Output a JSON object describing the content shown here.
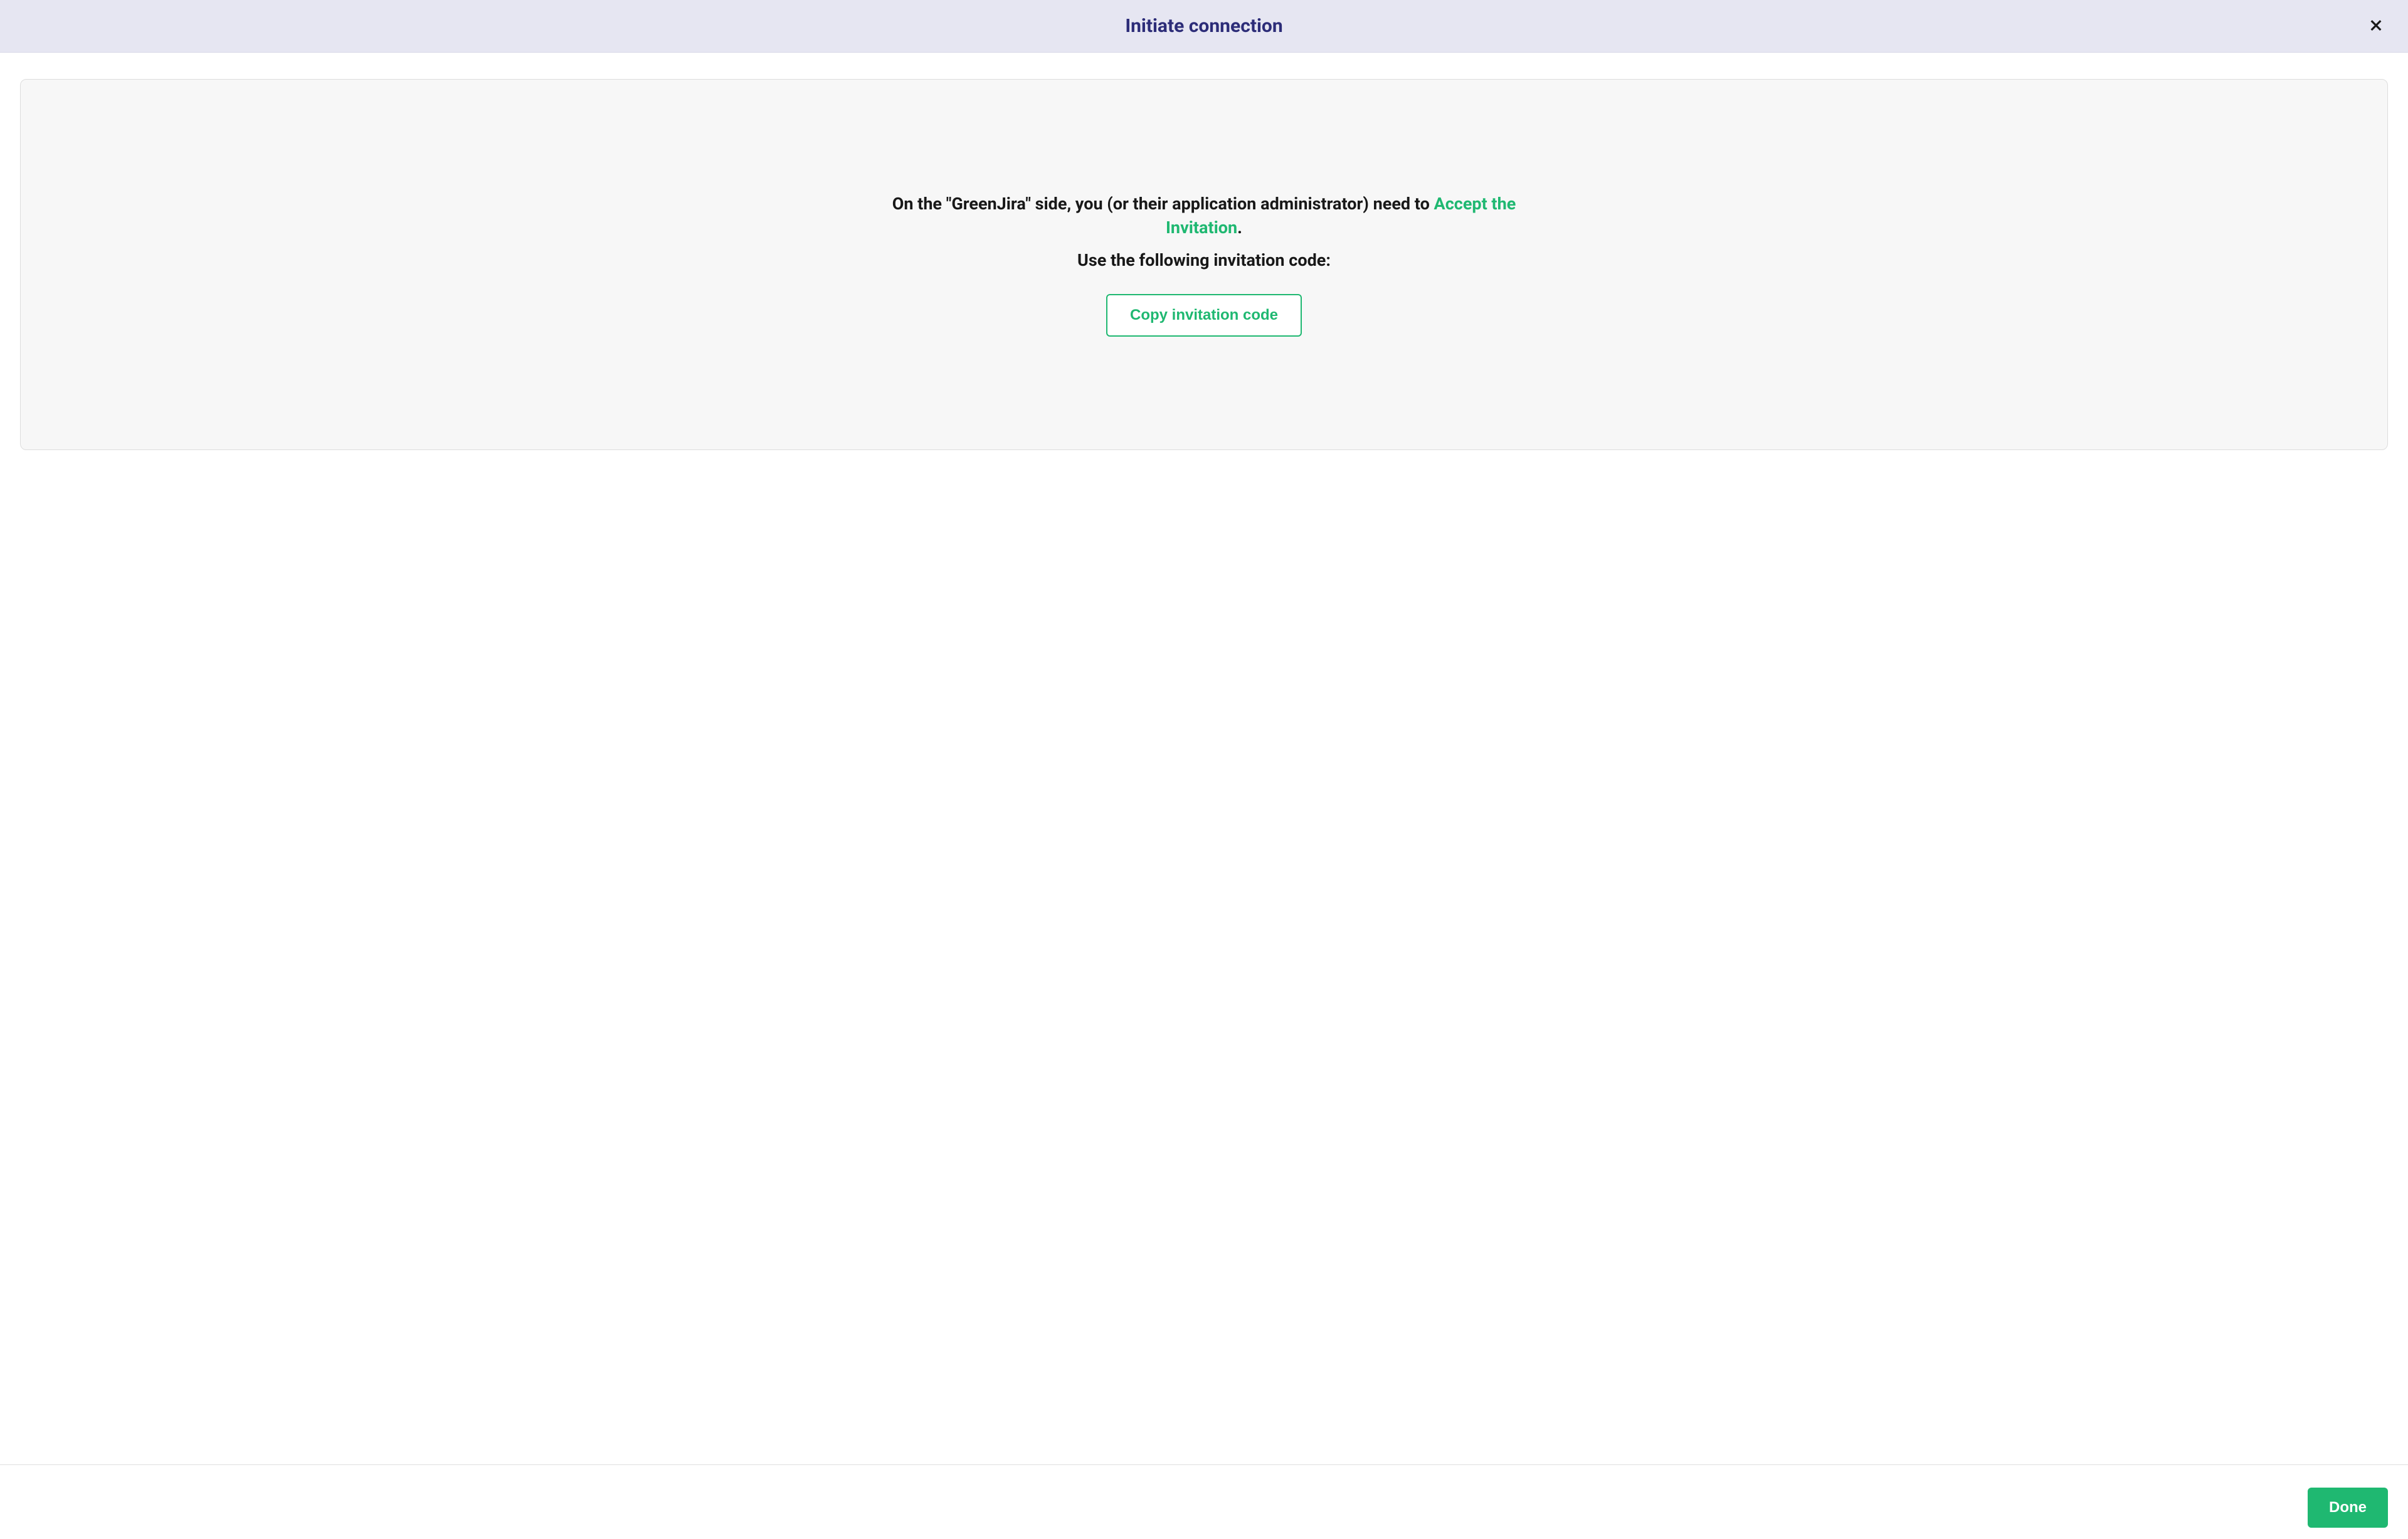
{
  "dialog": {
    "title": "Initiate connection"
  },
  "content": {
    "instruction_prefix": "On the \"GreenJira\" side, you (or their application administrator) need to ",
    "accept_link": "Accept the Invitation",
    "instruction_suffix": ".",
    "sub_instruction": "Use the following invitation code:",
    "copy_button": "Copy invitation code"
  },
  "footer": {
    "done_button": "Done"
  }
}
